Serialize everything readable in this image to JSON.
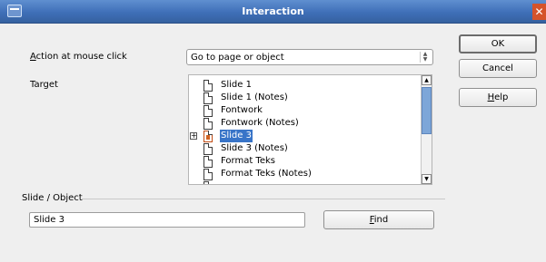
{
  "window": {
    "title": "Interaction",
    "close_glyph": "✕"
  },
  "labels": {
    "action_accel": "A",
    "action_rest": "ction at mouse click",
    "target": "Target",
    "slide_object": "Slide / Object"
  },
  "action_combo": {
    "value": "Go to page or object"
  },
  "buttons": {
    "ok": "OK",
    "cancel": "Cancel",
    "help_accel": "H",
    "help_rest": "elp",
    "find_accel": "F",
    "find_rest": "ind"
  },
  "target_tree": {
    "items": [
      {
        "label": "Slide 1"
      },
      {
        "label": "Slide 1 (Notes)"
      },
      {
        "label": "Fontwork"
      },
      {
        "label": "Fontwork (Notes)"
      },
      {
        "label": "Slide 3",
        "selected": true,
        "expandable": true
      },
      {
        "label": "Slide 3 (Notes)"
      },
      {
        "label": "Format Teks"
      },
      {
        "label": "Format Teks (Notes)"
      }
    ]
  },
  "slide_object_field": {
    "value": "Slide 3"
  }
}
